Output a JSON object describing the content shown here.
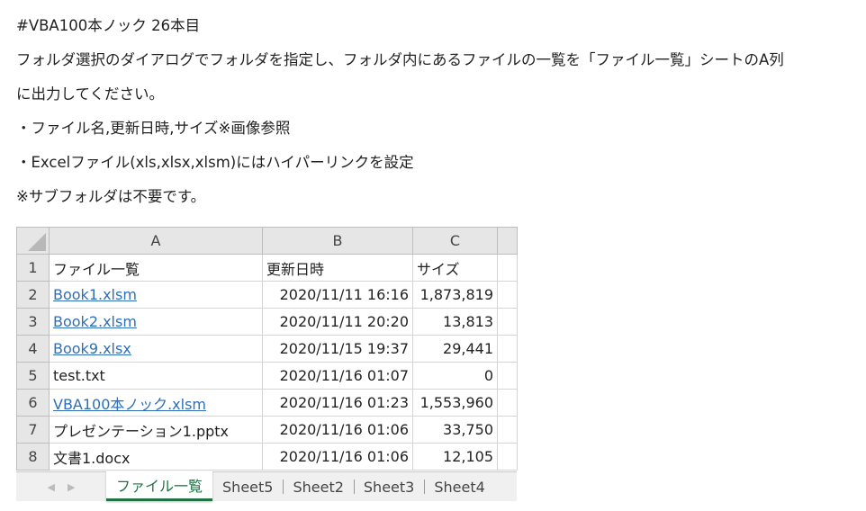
{
  "description": {
    "line1": "#VBA100本ノック 26本目",
    "line2": "フォルダ選択のダイアログでフォルダを指定し、フォルダ内にあるファイルの一覧を「ファイル一覧」シートのA列",
    "line3": "に出力してください。",
    "line4": "・ファイル名,更新日時,サイズ※画像参照",
    "line5": "・Excelファイル(xls,xlsx,xlsm)にはハイパーリンクを設定",
    "line6": "※サブフォルダは不要です。"
  },
  "spreadsheet": {
    "columns": [
      "A",
      "B",
      "C"
    ],
    "rows": [
      {
        "num": "1",
        "a": "ファイル一覧",
        "b": "更新日時",
        "c": "サイズ"
      },
      {
        "num": "2",
        "a": "Book1.xlsm",
        "b": "2020/11/11 16:16",
        "c": "1,873,819"
      },
      {
        "num": "3",
        "a": "Book2.xlsm",
        "b": "2020/11/11 20:20",
        "c": "13,813"
      },
      {
        "num": "4",
        "a": "Book9.xlsx",
        "b": "2020/11/15 19:37",
        "c": "29,441"
      },
      {
        "num": "5",
        "a": "test.txt",
        "b": "2020/11/16 01:07",
        "c": "0"
      },
      {
        "num": "6",
        "a": "VBA100本ノック.xlsm",
        "b": "2020/11/16 01:23",
        "c": "1,553,960"
      },
      {
        "num": "7",
        "a": "プレゼンテーション1.pptx",
        "b": "2020/11/16 01:06",
        "c": "33,750"
      },
      {
        "num": "8",
        "a": "文書1.docx",
        "b": "2020/11/16 01:06",
        "c": "12,105"
      }
    ],
    "tabs": [
      "ファイル一覧",
      "Sheet5",
      "Sheet2",
      "Sheet3",
      "Sheet4"
    ],
    "active_tab": "ファイル一覧",
    "link_color": "#2e6fb8",
    "tab_accent": "#217346"
  }
}
